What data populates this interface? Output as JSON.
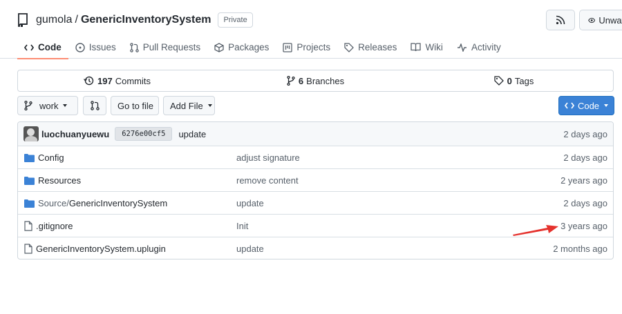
{
  "repo": {
    "owner": "gumola",
    "separator": "/",
    "name": "GenericInventorySystem",
    "visibility": "Private",
    "watch_label": "Unwatch"
  },
  "nav": {
    "items": [
      {
        "label": "Code",
        "icon": "code-icon",
        "active": true
      },
      {
        "label": "Issues",
        "icon": "issue-icon"
      },
      {
        "label": "Pull Requests",
        "icon": "pull-request-icon"
      },
      {
        "label": "Packages",
        "icon": "package-icon"
      },
      {
        "label": "Projects",
        "icon": "project-icon"
      },
      {
        "label": "Releases",
        "icon": "tag-icon"
      },
      {
        "label": "Wiki",
        "icon": "book-icon"
      },
      {
        "label": "Activity",
        "icon": "pulse-icon"
      }
    ]
  },
  "stats": {
    "commits_count": "197",
    "commits_label": "Commits",
    "branches_count": "6",
    "branches_label": "Branches",
    "tags_count": "0",
    "tags_label": "Tags"
  },
  "controls": {
    "branch": "work",
    "go_to_file": "Go to file",
    "add_file": "Add File",
    "code": "Code"
  },
  "latest_commit": {
    "author": "luochuanyuewu",
    "sha": "6276e00cf5",
    "message": "update",
    "time": "2 days ago"
  },
  "files": [
    {
      "type": "folder",
      "prefix": "",
      "name": "Config",
      "message": "adjust signature",
      "age": "2 days ago"
    },
    {
      "type": "folder",
      "prefix": "",
      "name": "Resources",
      "message": "remove content",
      "age": "2 years ago"
    },
    {
      "type": "folder",
      "prefix": "Source/",
      "name": "GenericInventorySystem",
      "message": "update",
      "age": "2 days ago"
    },
    {
      "type": "file",
      "prefix": "",
      "name": ".gitignore",
      "message": "Init",
      "age": "3 years ago"
    },
    {
      "type": "file",
      "prefix": "",
      "name": "GenericInventorySystem.uplugin",
      "message": "update",
      "age": "2 months ago"
    }
  ],
  "colors": {
    "accent": "#3b82d6",
    "folder": "#54aeff",
    "annotation_arrow": "#e5322d"
  }
}
